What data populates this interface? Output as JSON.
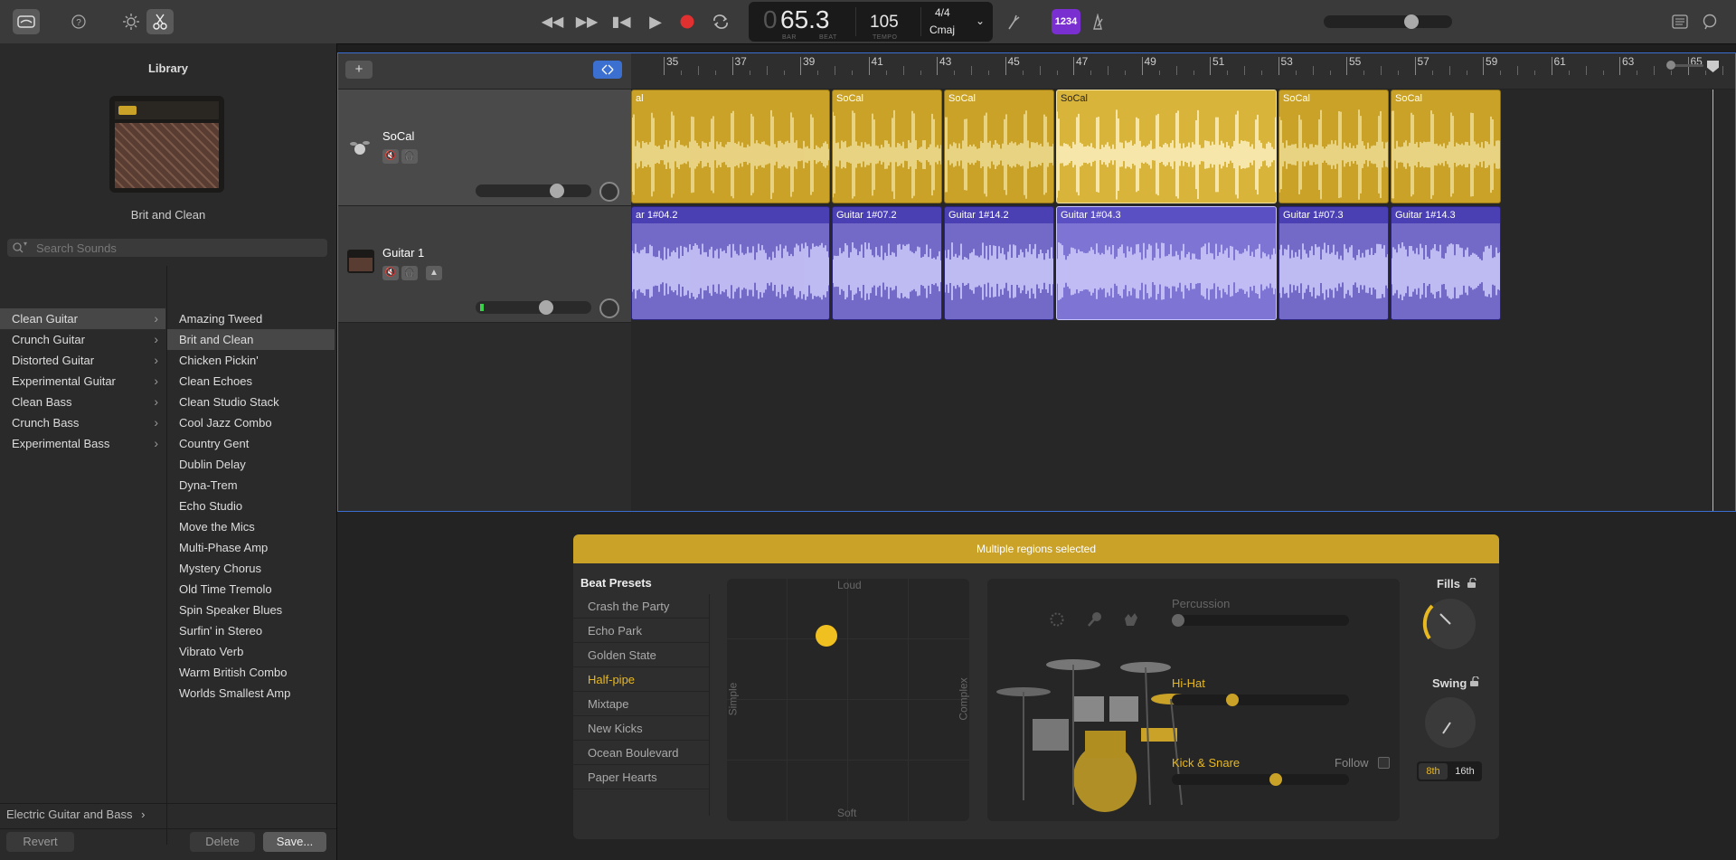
{
  "toolbar": {
    "lcd": {
      "bar": "65.3",
      "bar_prefix": "0",
      "bar_caption": "BAR",
      "beat_caption": "BEAT",
      "tempo": "105",
      "tempo_caption": "TEMPO",
      "time_signature": "4/4",
      "key": "Cmaj"
    },
    "count_in": "1234",
    "colors": {
      "accent": "#7a2fd0",
      "record": "#e03030"
    }
  },
  "library": {
    "title": "Library",
    "patch_name": "Brit and Clean",
    "search_placeholder": "Search Sounds",
    "categories": [
      {
        "label": "Clean Guitar"
      },
      {
        "label": "Crunch Guitar"
      },
      {
        "label": "Distorted Guitar"
      },
      {
        "label": "Experimental Guitar"
      },
      {
        "label": "Clean Bass"
      },
      {
        "label": "Crunch Bass"
      },
      {
        "label": "Experimental Bass"
      }
    ],
    "presets": [
      {
        "label": "Amazing Tweed"
      },
      {
        "label": "Brit and Clean"
      },
      {
        "label": "Chicken Pickin'"
      },
      {
        "label": "Clean Echoes"
      },
      {
        "label": "Clean Studio Stack"
      },
      {
        "label": "Cool Jazz Combo"
      },
      {
        "label": "Country Gent"
      },
      {
        "label": "Dublin Delay"
      },
      {
        "label": "Dyna-Trem"
      },
      {
        "label": "Echo Studio"
      },
      {
        "label": "Move the Mics"
      },
      {
        "label": "Multi-Phase Amp"
      },
      {
        "label": "Mystery Chorus"
      },
      {
        "label": "Old Time Tremolo"
      },
      {
        "label": "Spin Speaker Blues"
      },
      {
        "label": "Surfin' in Stereo"
      },
      {
        "label": "Vibrato Verb"
      },
      {
        "label": "Warm British Combo"
      },
      {
        "label": "Worlds Smallest Amp"
      }
    ],
    "breadcrumb": "Electric Guitar and Bass",
    "revert_label": "Revert",
    "delete_label": "Delete",
    "save_label": "Save..."
  },
  "tracks_area": {
    "add_label": "+",
    "ruler": [
      "35",
      "37",
      "39",
      "41",
      "43",
      "45",
      "47",
      "49",
      "51",
      "53",
      "55",
      "57",
      "59",
      "61",
      "63",
      "65"
    ],
    "tracks": [
      {
        "name": "SoCal",
        "regions": [
          {
            "name": "al"
          },
          {
            "name": "SoCal"
          },
          {
            "name": "SoCal"
          },
          {
            "name": "SoCal"
          },
          {
            "name": "SoCal"
          },
          {
            "name": "SoCal"
          }
        ]
      },
      {
        "name": "Guitar 1",
        "regions": [
          {
            "name": "ar 1#04.2"
          },
          {
            "name": "Guitar 1#07.2"
          },
          {
            "name": "Guitar 1#14.2"
          },
          {
            "name": "Guitar 1#04.3"
          },
          {
            "name": "Guitar 1#07.3"
          },
          {
            "name": "Guitar 1#14.3"
          }
        ]
      }
    ]
  },
  "editor": {
    "title": "Multiple regions selected",
    "beat_presets_title": "Beat Presets",
    "presets": [
      {
        "label": "Crash the Party"
      },
      {
        "label": "Echo Park"
      },
      {
        "label": "Golden State"
      },
      {
        "label": "Half-pipe"
      },
      {
        "label": "Mixtape"
      },
      {
        "label": "New Kicks"
      },
      {
        "label": "Ocean Boulevard"
      },
      {
        "label": "Paper Hearts"
      }
    ],
    "xy_pad": {
      "top": "Loud",
      "bottom": "Soft",
      "left": "Simple",
      "right": "Complex"
    },
    "percussion_label": "Percussion",
    "hihat_label": "Hi-Hat",
    "kick_snare_label": "Kick & Snare",
    "follow_label": "Follow",
    "fills_label": "Fills",
    "swing_label": "Swing",
    "swing_8th": "8th",
    "swing_16th": "16th",
    "colors": {
      "accent": "#e8b820",
      "header": "#c9a227"
    }
  }
}
